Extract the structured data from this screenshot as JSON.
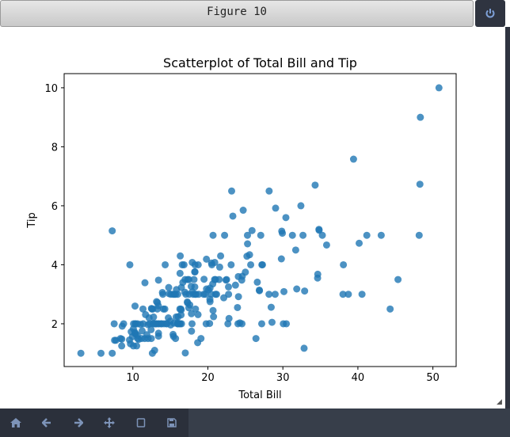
{
  "window": {
    "title": "Figure 10"
  },
  "toolbar": {
    "buttons": [
      "home",
      "back",
      "forward",
      "pan",
      "zoom",
      "save"
    ]
  },
  "chart_data": {
    "type": "scatter",
    "title": "Scatterplot of Total Bill and Tip",
    "xlabel": "Total Bill",
    "ylabel": "Tip",
    "xlim": [
      0.84,
      53.1
    ],
    "ylim": [
      0.55,
      10.48
    ],
    "xticks": [
      "10",
      "20",
      "30",
      "40",
      "50"
    ],
    "yticks": [
      "2",
      "4",
      "6",
      "8",
      "10"
    ],
    "grid": false,
    "color": "#1f77b4",
    "points": [
      [
        16.99,
        1.01
      ],
      [
        10.34,
        1.66
      ],
      [
        21.01,
        3.5
      ],
      [
        23.68,
        3.31
      ],
      [
        24.59,
        3.61
      ],
      [
        25.29,
        4.71
      ],
      [
        8.77,
        2.0
      ],
      [
        26.88,
        3.12
      ],
      [
        15.04,
        1.96
      ],
      [
        14.78,
        3.23
      ],
      [
        10.27,
        1.71
      ],
      [
        35.26,
        5.0
      ],
      [
        15.42,
        1.57
      ],
      [
        18.43,
        3.0
      ],
      [
        14.83,
        3.02
      ],
      [
        21.58,
        3.92
      ],
      [
        10.33,
        1.67
      ],
      [
        16.29,
        3.71
      ],
      [
        16.97,
        3.5
      ],
      [
        20.65,
        3.35
      ],
      [
        17.92,
        4.08
      ],
      [
        20.29,
        2.75
      ],
      [
        15.77,
        2.23
      ],
      [
        39.42,
        7.58
      ],
      [
        19.82,
        3.18
      ],
      [
        17.81,
        2.34
      ],
      [
        13.37,
        2.0
      ],
      [
        12.69,
        2.0
      ],
      [
        21.7,
        4.3
      ],
      [
        19.65,
        3.0
      ],
      [
        9.55,
        1.45
      ],
      [
        18.35,
        2.5
      ],
      [
        15.06,
        3.0
      ],
      [
        20.69,
        2.45
      ],
      [
        17.78,
        3.27
      ],
      [
        24.06,
        3.6
      ],
      [
        16.31,
        2.0
      ],
      [
        16.93,
        3.07
      ],
      [
        18.69,
        2.31
      ],
      [
        31.27,
        5.0
      ],
      [
        16.04,
        2.24
      ],
      [
        17.46,
        2.54
      ],
      [
        13.94,
        3.06
      ],
      [
        9.68,
        1.32
      ],
      [
        30.4,
        5.6
      ],
      [
        18.29,
        3.0
      ],
      [
        22.23,
        5.0
      ],
      [
        32.4,
        6.0
      ],
      [
        28.55,
        2.05
      ],
      [
        18.04,
        3.0
      ],
      [
        12.54,
        2.5
      ],
      [
        10.29,
        2.6
      ],
      [
        34.81,
        5.2
      ],
      [
        9.94,
        1.56
      ],
      [
        25.56,
        4.34
      ],
      [
        19.49,
        3.51
      ],
      [
        38.01,
        3.0
      ],
      [
        26.41,
        1.5
      ],
      [
        11.24,
        1.76
      ],
      [
        48.27,
        6.73
      ],
      [
        20.29,
        3.21
      ],
      [
        13.81,
        2.0
      ],
      [
        11.02,
        1.98
      ],
      [
        18.29,
        3.76
      ],
      [
        17.59,
        2.64
      ],
      [
        20.08,
        3.15
      ],
      [
        16.45,
        2.47
      ],
      [
        3.07,
        1.0
      ],
      [
        20.23,
        2.01
      ],
      [
        15.01,
        2.09
      ],
      [
        12.02,
        1.97
      ],
      [
        17.07,
        3.0
      ],
      [
        26.86,
        3.14
      ],
      [
        25.28,
        5.0
      ],
      [
        14.73,
        2.2
      ],
      [
        10.51,
        1.25
      ],
      [
        17.92,
        3.08
      ],
      [
        27.2,
        4.0
      ],
      [
        22.76,
        3.0
      ],
      [
        17.29,
        2.71
      ],
      [
        19.44,
        3.0
      ],
      [
        16.66,
        3.4
      ],
      [
        10.07,
        1.83
      ],
      [
        32.68,
        5.0
      ],
      [
        15.98,
        2.03
      ],
      [
        34.83,
        5.17
      ],
      [
        13.03,
        2.0
      ],
      [
        18.28,
        4.0
      ],
      [
        24.71,
        5.85
      ],
      [
        21.16,
        3.0
      ],
      [
        28.97,
        3.0
      ],
      [
        22.49,
        3.5
      ],
      [
        5.75,
        1.0
      ],
      [
        16.32,
        4.3
      ],
      [
        22.75,
        3.25
      ],
      [
        40.17,
        4.73
      ],
      [
        27.28,
        4.0
      ],
      [
        12.03,
        1.5
      ],
      [
        21.01,
        3.0
      ],
      [
        12.46,
        1.5
      ],
      [
        11.35,
        2.5
      ],
      [
        15.38,
        3.0
      ],
      [
        44.3,
        2.5
      ],
      [
        22.42,
        3.48
      ],
      [
        20.92,
        4.08
      ],
      [
        15.36,
        1.64
      ],
      [
        20.49,
        4.06
      ],
      [
        25.21,
        4.29
      ],
      [
        18.24,
        3.76
      ],
      [
        14.31,
        4.0
      ],
      [
        14.0,
        3.0
      ],
      [
        7.25,
        1.0
      ],
      [
        38.07,
        4.0
      ],
      [
        23.95,
        2.55
      ],
      [
        25.71,
        4.0
      ],
      [
        17.31,
        3.5
      ],
      [
        29.93,
        5.07
      ],
      [
        10.65,
        1.5
      ],
      [
        12.43,
        1.8
      ],
      [
        24.08,
        2.92
      ],
      [
        11.69,
        2.31
      ],
      [
        13.42,
        1.68
      ],
      [
        14.26,
        2.5
      ],
      [
        15.95,
        2.0
      ],
      [
        12.48,
        2.52
      ],
      [
        29.8,
        4.2
      ],
      [
        8.52,
        1.48
      ],
      [
        14.52,
        2.0
      ],
      [
        11.38,
        2.0
      ],
      [
        22.82,
        2.18
      ],
      [
        19.08,
        1.5
      ],
      [
        20.27,
        2.83
      ],
      [
        11.17,
        1.5
      ],
      [
        12.26,
        2.0
      ],
      [
        18.26,
        3.25
      ],
      [
        8.51,
        1.25
      ],
      [
        10.33,
        2.0
      ],
      [
        14.15,
        2.0
      ],
      [
        16.0,
        2.0
      ],
      [
        13.16,
        2.75
      ],
      [
        17.47,
        3.5
      ],
      [
        34.3,
        6.7
      ],
      [
        41.19,
        5.0
      ],
      [
        27.05,
        5.0
      ],
      [
        16.43,
        2.3
      ],
      [
        8.35,
        1.5
      ],
      [
        18.64,
        1.36
      ],
      [
        11.87,
        1.63
      ],
      [
        9.78,
        1.73
      ],
      [
        7.51,
        2.0
      ],
      [
        14.07,
        2.5
      ],
      [
        13.13,
        2.0
      ],
      [
        17.26,
        2.74
      ],
      [
        24.55,
        2.0
      ],
      [
        19.77,
        2.0
      ],
      [
        29.85,
        5.14
      ],
      [
        48.17,
        5.0
      ],
      [
        25.0,
        3.75
      ],
      [
        13.39,
        2.61
      ],
      [
        16.49,
        2.0
      ],
      [
        21.5,
        3.5
      ],
      [
        12.66,
        2.5
      ],
      [
        16.21,
        2.0
      ],
      [
        13.81,
        2.0
      ],
      [
        17.51,
        3.0
      ],
      [
        24.52,
        3.48
      ],
      [
        20.76,
        2.24
      ],
      [
        31.71,
        4.5
      ],
      [
        10.59,
        1.61
      ],
      [
        10.63,
        2.0
      ],
      [
        50.81,
        10.0
      ],
      [
        15.81,
        3.16
      ],
      [
        7.25,
        5.15
      ],
      [
        31.85,
        3.18
      ],
      [
        16.82,
        4.0
      ],
      [
        32.9,
        3.11
      ],
      [
        17.89,
        2.0
      ],
      [
        14.48,
        2.0
      ],
      [
        9.6,
        4.0
      ],
      [
        34.63,
        3.55
      ],
      [
        34.65,
        3.68
      ],
      [
        23.33,
        5.65
      ],
      [
        45.35,
        3.5
      ],
      [
        23.17,
        6.5
      ],
      [
        40.55,
        3.0
      ],
      [
        20.69,
        5.0
      ],
      [
        20.9,
        3.5
      ],
      [
        30.46,
        2.0
      ],
      [
        18.15,
        3.5
      ],
      [
        23.1,
        4.0
      ],
      [
        15.69,
        1.5
      ],
      [
        19.81,
        4.19
      ],
      [
        28.44,
        2.56
      ],
      [
        15.48,
        2.02
      ],
      [
        16.58,
        4.0
      ],
      [
        7.56,
        1.44
      ],
      [
        10.34,
        2.0
      ],
      [
        43.11,
        5.0
      ],
      [
        13.0,
        2.0
      ],
      [
        13.51,
        2.0
      ],
      [
        18.71,
        4.0
      ],
      [
        12.74,
        2.01
      ],
      [
        13.0,
        2.0
      ],
      [
        16.4,
        2.5
      ],
      [
        20.53,
        4.0
      ],
      [
        16.47,
        3.23
      ],
      [
        26.59,
        3.41
      ],
      [
        38.73,
        3.0
      ],
      [
        24.27,
        2.03
      ],
      [
        12.76,
        2.23
      ],
      [
        30.06,
        2.0
      ],
      [
        25.89,
        5.16
      ],
      [
        48.33,
        9.0
      ],
      [
        13.27,
        2.5
      ],
      [
        28.17,
        6.5
      ],
      [
        12.9,
        1.1
      ],
      [
        28.15,
        3.0
      ],
      [
        11.59,
        1.5
      ],
      [
        7.74,
        1.44
      ],
      [
        30.14,
        3.09
      ],
      [
        12.16,
        2.2
      ],
      [
        13.42,
        3.48
      ],
      [
        8.58,
        1.92
      ],
      [
        15.98,
        3.0
      ],
      [
        13.42,
        1.58
      ],
      [
        16.27,
        2.5
      ],
      [
        10.09,
        2.0
      ],
      [
        20.45,
        3.0
      ],
      [
        13.28,
        2.72
      ],
      [
        22.12,
        2.88
      ],
      [
        24.01,
        2.0
      ],
      [
        15.69,
        3.0
      ],
      [
        11.61,
        3.39
      ],
      [
        10.77,
        1.47
      ],
      [
        15.53,
        3.0
      ],
      [
        10.07,
        1.25
      ],
      [
        12.6,
        1.0
      ],
      [
        32.83,
        1.17
      ],
      [
        35.83,
        4.67
      ],
      [
        29.03,
        5.92
      ],
      [
        27.18,
        2.0
      ],
      [
        22.67,
        2.0
      ],
      [
        17.82,
        1.75
      ],
      [
        18.78,
        3.0
      ]
    ]
  }
}
